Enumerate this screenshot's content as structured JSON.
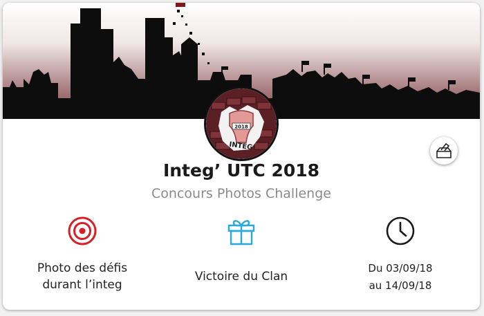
{
  "event": {
    "title": "Integ’ UTC 2018",
    "subtitle": "Concours Photos Challenge",
    "logo_text": "INTEG",
    "logo_year": "2018"
  },
  "info": [
    {
      "icon": "target-icon",
      "line1": "Photo des défis",
      "line2": "durant l’integ"
    },
    {
      "icon": "gift-icon",
      "line1": "Victoire du Clan"
    },
    {
      "icon": "clock-icon",
      "line1": "Du 03/09/18",
      "line2": "au 14/09/18"
    }
  ],
  "colors": {
    "sky_top": "#ffffff",
    "sky_bottom": "#7a3a3e",
    "skyline": "#0d0d0d",
    "target": "#d91f26",
    "gift": "#29a8e0",
    "clock": "#1a1a1a"
  }
}
